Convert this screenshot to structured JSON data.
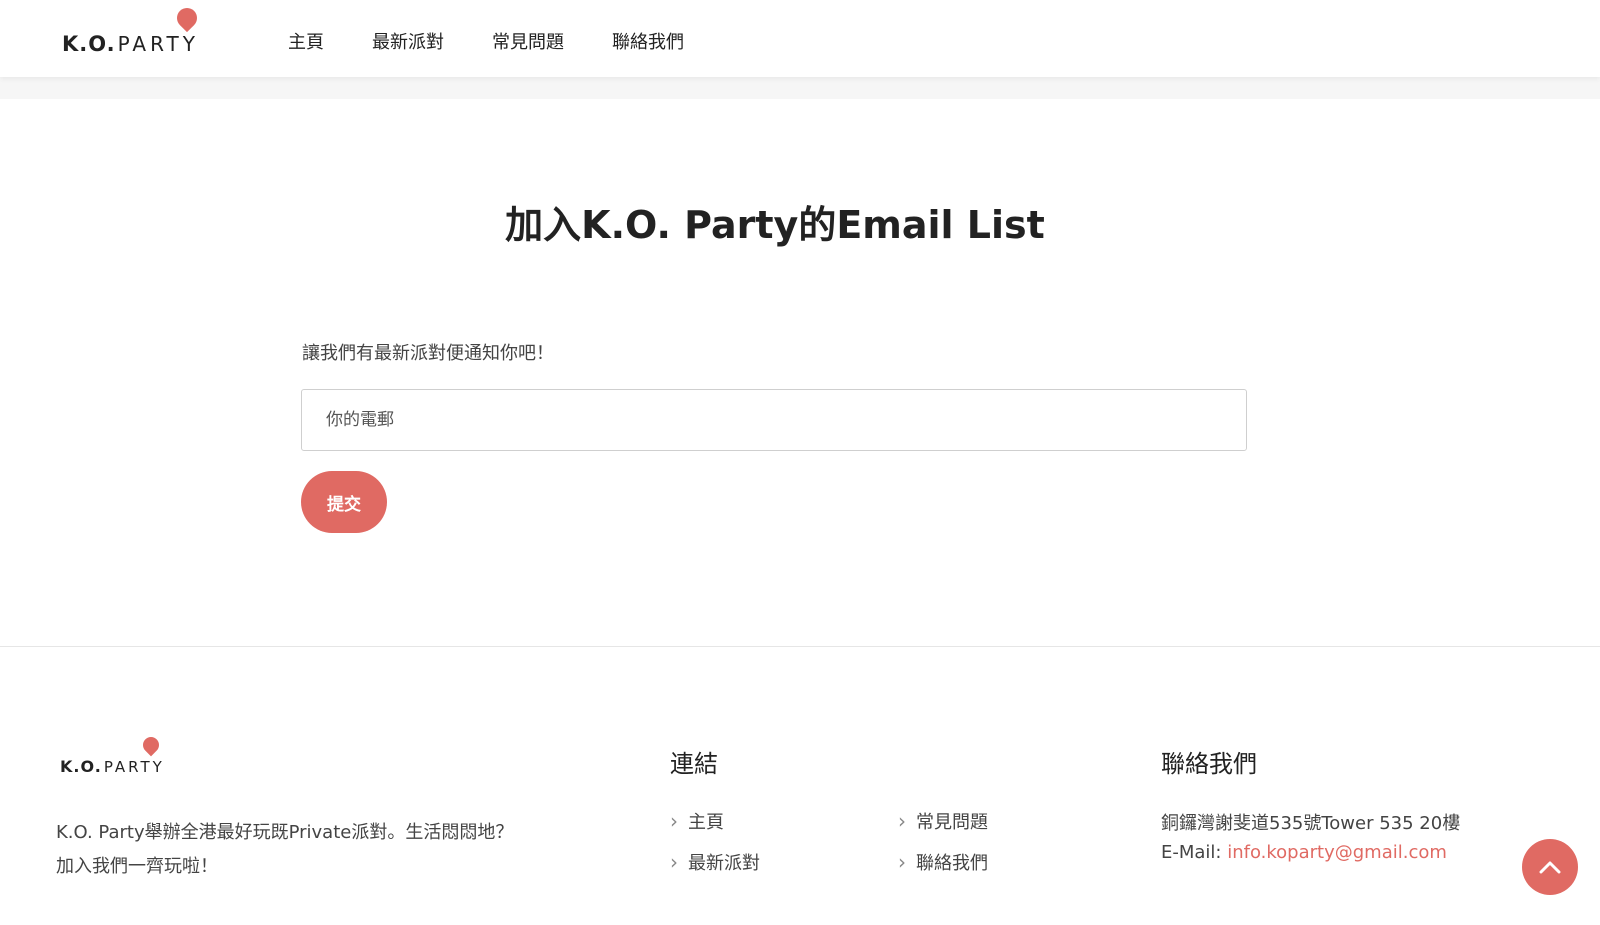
{
  "colors": {
    "accent": "#e06a63",
    "gray_band": "#f6f6f6"
  },
  "header": {
    "logo_ko": "K.O.",
    "logo_party": "PARTY",
    "nav": [
      {
        "label": "主頁"
      },
      {
        "label": "最新派對"
      },
      {
        "label": "常見問題"
      },
      {
        "label": "聯絡我們"
      }
    ]
  },
  "main": {
    "title": "加入K.O. Party的Email List",
    "intro": "讓我們有最新派對便通知你吧！",
    "email_placeholder": "你的電郵",
    "email_value": "",
    "submit_label": "提交"
  },
  "footer": {
    "logo_ko": "K.O.",
    "logo_party": "PARTY",
    "description": "K.O. Party舉辦全港最好玩既Private派對。生活悶悶地？加入我們一齊玩啦！",
    "links_heading": "連結",
    "links": [
      {
        "label": "主頁"
      },
      {
        "label": "常見問題"
      },
      {
        "label": "最新派對"
      },
      {
        "label": "聯絡我們"
      }
    ],
    "contact_heading": "聯絡我們",
    "address": "銅鑼灣謝斐道535號Tower 535 20樓",
    "email_prefix": "E-Mail: ",
    "email": "info.koparty@gmail.com"
  },
  "scroll_top": {
    "icon": "chevron-up-icon"
  }
}
